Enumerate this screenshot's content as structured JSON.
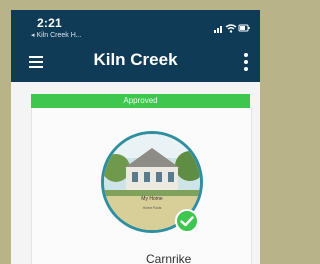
{
  "status_bar": {
    "time": "2:21",
    "back_app": "◂ Kiln Creek H..."
  },
  "app_bar": {
    "title": "Kiln Creek",
    "menu_icon": "hamburger-menu-icon",
    "more_icon": "more-vertical-icon"
  },
  "card": {
    "status": "Approved",
    "photo_caption": "My Home",
    "photo_subcaption": "Home Facts",
    "name": "Carnrike",
    "check_icon": "check-circle-icon"
  },
  "colors": {
    "header": "#0f3b57",
    "approved": "#3fc64f",
    "frame": "#b9b488"
  }
}
